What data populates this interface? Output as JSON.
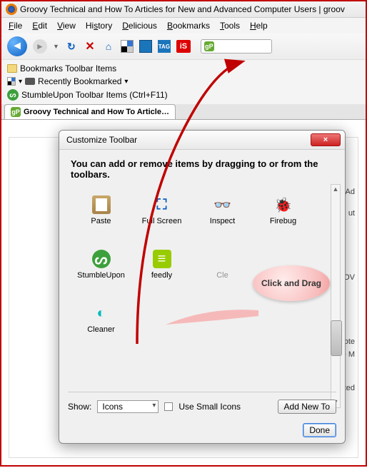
{
  "window": {
    "title": "Groovy Technical and How To Articles for New and Advanced Computer Users | groov"
  },
  "menu": [
    "File",
    "Edit",
    "View",
    "History",
    "Delicious",
    "Bookmarks",
    "Tools",
    "Help"
  ],
  "toolbar": {
    "tag_label": "TAG",
    "is_label": "iS",
    "search_prefix": "gP"
  },
  "bookmarks": {
    "row1": "Bookmarks Toolbar Items",
    "row2": "Recently Bookmarked",
    "row3": "StumbleUpon Toolbar Items (Ctrl+F11)"
  },
  "tab": {
    "label": "Groovy Technical and How To Article…"
  },
  "side": {
    "t1": "Ad",
    "t2": "ut",
    "t3": "DOV",
    "t4": "ote",
    "t5": "ke M",
    "t6": "ated"
  },
  "dialog": {
    "title": "Customize Toolbar",
    "close_x": "×",
    "instruction": "You can add or remove items by dragging to or from the toolbars.",
    "items": {
      "paste": "Paste",
      "fullscreen": "Full Screen",
      "inspect": "Inspect",
      "firebug": "Firebug",
      "stumble": "StumbleUpon",
      "feedly": "feedly",
      "cle": "Cle",
      "cleaner": "Cleaner"
    },
    "show_label": "Show:",
    "show_value": "Icons",
    "small_icons": "Use Small Icons",
    "add_new": "Add New To",
    "done": "Done"
  },
  "callout": {
    "text": "Click and Drag"
  }
}
